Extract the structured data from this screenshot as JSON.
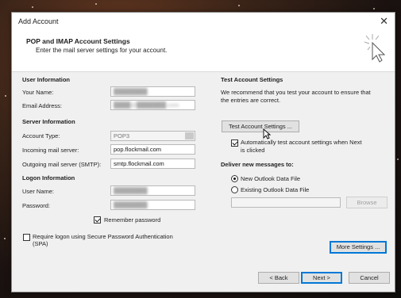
{
  "window": {
    "title": "Add Account",
    "close_glyph": "✕"
  },
  "header": {
    "title": "POP and IMAP Account Settings",
    "subtitle": "Enter the mail server settings for your account.",
    "icon": "wizard-cursor-icon"
  },
  "user_info": {
    "heading": "User Information",
    "your_name_label": "Your Name:",
    "your_name_value": "████████",
    "email_label": "Email Address:",
    "email_value": "████@███████.com"
  },
  "server_info": {
    "heading": "Server Information",
    "account_type_label": "Account Type:",
    "account_type_value": "POP3",
    "incoming_label": "Incoming mail server:",
    "incoming_value": "pop.flockmail.com",
    "outgoing_label": "Outgoing mail server (SMTP):",
    "outgoing_value": "smtp.flockmail.com"
  },
  "logon_info": {
    "heading": "Logon Information",
    "username_label": "User Name:",
    "username_value": "████████",
    "password_label": "Password:",
    "password_value": "████████",
    "remember_password_label": "Remember password",
    "remember_password_checked": true,
    "spa_label_line1": "Require logon using Secure Password Authentication",
    "spa_label_line2": "(SPA)",
    "spa_checked": false
  },
  "test_settings": {
    "heading": "Test Account Settings",
    "description_line1": "We recommend that you test your account to ensure that",
    "description_line2": "the entries are correct.",
    "test_button_label": "Test Account Settings ...",
    "auto_test_label_line1": "Automatically test account settings when Next",
    "auto_test_label_line2": "is clicked",
    "auto_test_checked": true
  },
  "deliver": {
    "heading": "Deliver new messages to:",
    "new_data_file_label": "New Outlook Data File",
    "existing_data_file_label": "Existing Outlook Data File",
    "selected": "new",
    "existing_path_value": "",
    "browse_label": "Browse"
  },
  "buttons": {
    "more_settings": "More Settings ...",
    "back": "< Back",
    "next": "Next >",
    "cancel": "Cancel"
  },
  "colors": {
    "accent": "#0078d7",
    "dialog_bg": "#f0f0f0",
    "header_bg": "#ffffff"
  }
}
